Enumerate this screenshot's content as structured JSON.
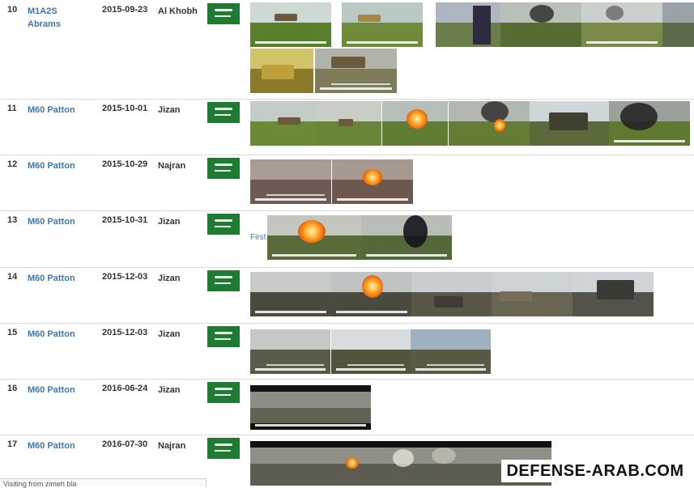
{
  "rows": [
    {
      "num": "10",
      "model": "M1A2S Abrams",
      "date": "2015-09-23",
      "location": "Al Khobh",
      "thumb_count": 8
    },
    {
      "num": "11",
      "model": "M60 Patton",
      "date": "2015-10-01",
      "location": "Jizan",
      "thumb_count": 6
    },
    {
      "num": "12",
      "model": "M60 Patton",
      "date": "2015-10-29",
      "location": "Najran",
      "thumb_count": 2
    },
    {
      "num": "13",
      "model": "M60 Patton",
      "date": "2015-10-31",
      "location": "Jizan",
      "thumb_count": 2,
      "link": "First"
    },
    {
      "num": "14",
      "model": "M60 Patton",
      "date": "2015-12-03",
      "location": "Jizan",
      "thumb_count": 5
    },
    {
      "num": "15",
      "model": "M60 Patton",
      "date": "2015-12-03",
      "location": "Jizan",
      "thumb_count": 3
    },
    {
      "num": "16",
      "model": "M60 Patton",
      "date": "2016-06-24",
      "location": "Jizan",
      "thumb_count": 1
    },
    {
      "num": "17",
      "model": "M60 Patton",
      "date": "2016-07-30",
      "location": "Najran",
      "thumb_count": 4
    }
  ],
  "watermark": "DEFENSE-ARAB.COM",
  "bottom_strip": "Visiting from zimeh bla",
  "colors": {
    "link": "#3a78b5",
    "flag": "#1f7a32",
    "divider": "#d9d9d9"
  }
}
